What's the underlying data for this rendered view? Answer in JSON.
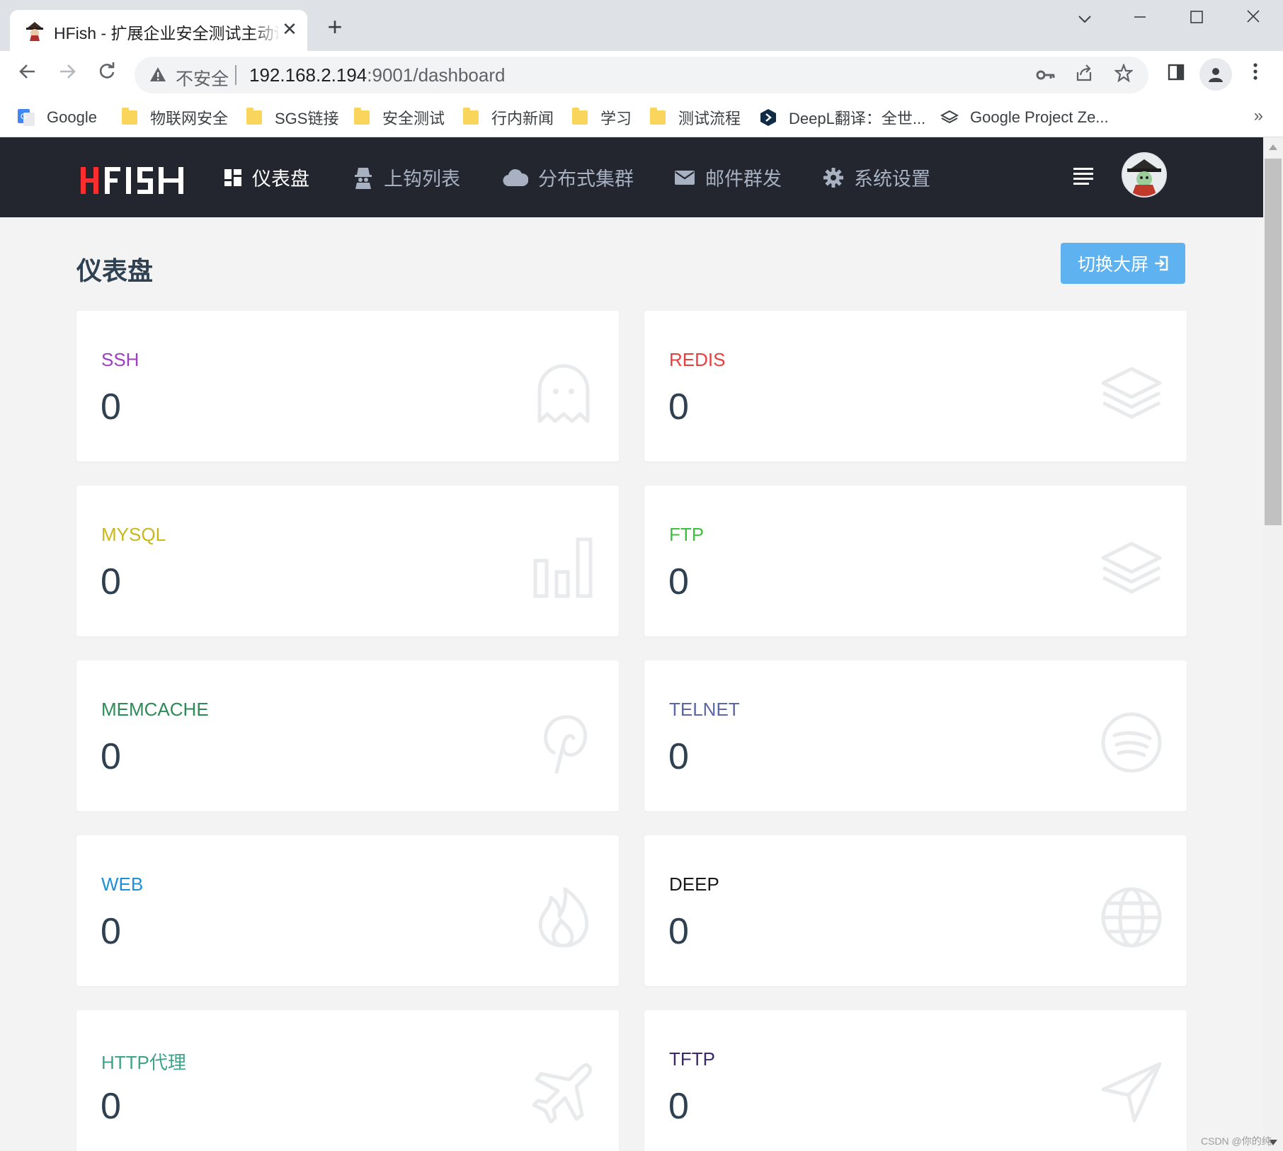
{
  "browser": {
    "tab_title": "HFish - 扩展企业安全测试主动诱",
    "tab_close": "✕",
    "new_tab": "+",
    "omnibox_insecure": "不安全",
    "url_host": "192.168.2.194",
    "url_path": ":9001/dashboard",
    "bookmarks": [
      {
        "label": "Google",
        "type": "google"
      },
      {
        "label": "物联网安全",
        "type": "folder"
      },
      {
        "label": "SGS链接",
        "type": "folder"
      },
      {
        "label": "安全测试",
        "type": "folder"
      },
      {
        "label": "行内新闻",
        "type": "folder"
      },
      {
        "label": "学习",
        "type": "folder"
      },
      {
        "label": "测试流程",
        "type": "folder"
      },
      {
        "label": "DeepL翻译：全世...",
        "type": "deepl"
      },
      {
        "label": "Google Project Ze...",
        "type": "project-zero"
      }
    ],
    "bookmarks_more": "»"
  },
  "app": {
    "logo_text": "HFISH",
    "nav": [
      {
        "label": "仪表盘",
        "icon": "dashboard-icon",
        "active": true
      },
      {
        "label": "上钩列表",
        "icon": "spy-icon",
        "active": false
      },
      {
        "label": "分布式集群",
        "icon": "cloud-icon",
        "active": false
      },
      {
        "label": "邮件群发",
        "icon": "envelope-icon",
        "active": false
      },
      {
        "label": "系统设置",
        "icon": "gear-icon",
        "active": false
      }
    ],
    "page_title": "仪表盘",
    "switch_button": "切换大屏",
    "cards": [
      {
        "label": "SSH",
        "value": "0",
        "color": "#9c3fc0",
        "icon": "ghost-icon"
      },
      {
        "label": "REDIS",
        "value": "0",
        "color": "#e8403f",
        "icon": "layers-icon"
      },
      {
        "label": "MYSQL",
        "value": "0",
        "color": "#c9b81c",
        "icon": "bar-chart-icon"
      },
      {
        "label": "FTP",
        "value": "0",
        "color": "#3cc23c",
        "icon": "layers-icon"
      },
      {
        "label": "MEMCACHE",
        "value": "0",
        "color": "#2e8b57",
        "icon": "pinterest-icon"
      },
      {
        "label": "TELNET",
        "value": "0",
        "color": "#5b67a8",
        "icon": "spotify-icon"
      },
      {
        "label": "WEB",
        "value": "0",
        "color": "#1e90d8",
        "icon": "fire-icon"
      },
      {
        "label": "DEEP",
        "value": "0",
        "color": "#1a1a1a",
        "icon": "globe-icon"
      },
      {
        "label": "HTTP代理",
        "value": "0",
        "color": "#3fa38a",
        "icon": "plane-icon"
      },
      {
        "label": "TFTP",
        "value": "0",
        "color": "#3a2a6a",
        "icon": "send-icon"
      }
    ]
  },
  "watermark": "CSDN @你的纯"
}
